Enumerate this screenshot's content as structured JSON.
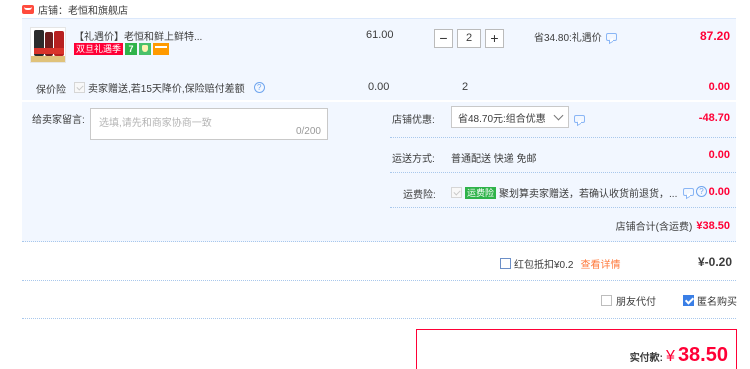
{
  "shop": {
    "label": "店铺：老恒和旗舰店"
  },
  "item": {
    "title": "【礼遇价】老恒和鲜上鲜特...",
    "tags": [
      "双旦礼遇季",
      "7",
      "",
      ""
    ],
    "unit_price": "61.00",
    "quantity": "2",
    "minus": "−",
    "plus": "+",
    "discount": "省34.80:礼遇价",
    "subtotal": "87.20"
  },
  "insurance": {
    "label": "保价险",
    "desc": "卖家赠送,若15天降价,保险赔付差额",
    "price": "0.00",
    "qty": "2",
    "total": "0.00"
  },
  "message": {
    "label": "给卖家留言:",
    "placeholder": "选填,请先和商家协商一致",
    "counter": "0/200"
  },
  "shop_discount": {
    "label": "店铺优惠:",
    "value": "省48.70元:组合优惠",
    "amount": "-48.70"
  },
  "shipping": {
    "label": "运送方式:",
    "value": "普通配送 快递 免邮",
    "amount": "0.00"
  },
  "freight_insurance": {
    "label": "运费险:",
    "badge": "运费险",
    "desc": "聚划算卖家赠送，若确认收货前退货，...",
    "amount": "0.00"
  },
  "shop_total": {
    "label": "店铺合计(含运费)",
    "amount": "¥38.50"
  },
  "red_packet": {
    "label": "红包抵扣¥0.2",
    "link": "查看详情",
    "amount": "¥-0.20"
  },
  "options": {
    "friend_pay": "朋友代付",
    "anonymous": "匿名购买"
  },
  "payment": {
    "label": "实付款:",
    "currency": "¥",
    "amount": "38.50"
  },
  "colors": {
    "accent_red": "#ff0036",
    "link_blue": "#3c9cff",
    "section_bg": "#f2f7ff"
  }
}
